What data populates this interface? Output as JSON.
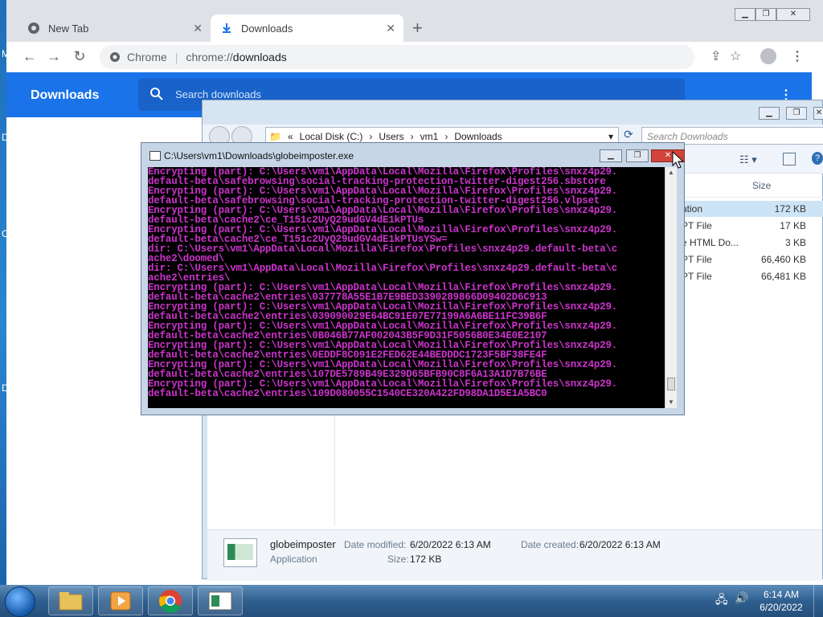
{
  "chrome": {
    "tabs": [
      {
        "label": "New Tab",
        "icon": "chrome-icon",
        "active": false
      },
      {
        "label": "Downloads",
        "icon": "download-icon",
        "active": true
      }
    ],
    "address": {
      "site_label": "Chrome",
      "url_prefix": "chrome://",
      "url_path": "downloads"
    },
    "downloads_page": {
      "title": "Downloads",
      "search_placeholder": "Search downloads"
    }
  },
  "explorer": {
    "breadcrumb": [
      "Local Disk (C:)",
      "Users",
      "vm1",
      "Downloads"
    ],
    "breadcrumb_prefix": "«",
    "search_placeholder": "Search Downloads",
    "column_header_size": "Size",
    "rows": [
      {
        "type": "ation",
        "size": "172 KB",
        "selected": true
      },
      {
        "type": "PT File",
        "size": "17 KB",
        "selected": false
      },
      {
        "type": "e HTML Do...",
        "size": "3 KB",
        "selected": false
      },
      {
        "type": "PT File",
        "size": "66,460 KB",
        "selected": false
      },
      {
        "type": "PT File",
        "size": "66,481 KB",
        "selected": false
      }
    ],
    "details": {
      "name": "globeimposter",
      "kind": "Application",
      "modified_label": "Date modified:",
      "modified_value": "6/20/2022 6:13 AM",
      "created_label": "Date created:",
      "created_value": "6/20/2022 6:13 AM",
      "size_label": "Size:",
      "size_value": "172 KB"
    }
  },
  "console": {
    "title": "C:\\Users\\vm1\\Downloads\\globeimposter.exe",
    "text_color": "#cc33cc",
    "lines": [
      "Encrypting (part): C:\\Users\\vm1\\AppData\\Local\\Mozilla\\Firefox\\Profiles\\snxz4p29.",
      "default-beta\\safebrowsing\\social-tracking-protection-twitter-digest256.sbstore",
      "Encrypting (part): C:\\Users\\vm1\\AppData\\Local\\Mozilla\\Firefox\\Profiles\\snxz4p29.",
      "default-beta\\safebrowsing\\social-tracking-protection-twitter-digest256.vlpset",
      "Encrypting (part): C:\\Users\\vm1\\AppData\\Local\\Mozilla\\Firefox\\Profiles\\snxz4p29.",
      "default-beta\\cache2\\ce_T151c2UyQ29udGV4dE1kPTUs",
      "Encrypting (part): C:\\Users\\vm1\\AppData\\Local\\Mozilla\\Firefox\\Profiles\\snxz4p29.",
      "default-beta\\cache2\\ce_T151c2UyQ29udGV4dE1kPTUsYSw=",
      "dir: C:\\Users\\vm1\\AppData\\Local\\Mozilla\\Firefox\\Profiles\\snxz4p29.default-beta\\c",
      "ache2\\doomed\\",
      "dir: C:\\Users\\vm1\\AppData\\Local\\Mozilla\\Firefox\\Profiles\\snxz4p29.default-beta\\c",
      "ache2\\entries\\",
      "Encrypting (part): C:\\Users\\vm1\\AppData\\Local\\Mozilla\\Firefox\\Profiles\\snxz4p29.",
      "default-beta\\cache2\\entries\\037778A55E1B7E9BED3390289866D09402D6C913",
      "Encrypting (part): C:\\Users\\vm1\\AppData\\Local\\Mozilla\\Firefox\\Profiles\\snxz4p29.",
      "default-beta\\cache2\\entries\\039090029E64BC91E07E77199A6A6BE11FC39B6F",
      "Encrypting (part): C:\\Users\\vm1\\AppData\\Local\\Mozilla\\Firefox\\Profiles\\snxz4p29.",
      "default-beta\\cache2\\entries\\0B046B77AF002043B5F9D31F5056B0E34E0E2107",
      "Encrypting (part): C:\\Users\\vm1\\AppData\\Local\\Mozilla\\Firefox\\Profiles\\snxz4p29.",
      "default-beta\\cache2\\entries\\0EDDF8C091E2FED62E44BEDDDC1723F5BF38FE4F",
      "Encrypting (part): C:\\Users\\vm1\\AppData\\Local\\Mozilla\\Firefox\\Profiles\\snxz4p29.",
      "default-beta\\cache2\\entries\\107DE5789B49E329D65BFB90C8F6A13A1D7B76BE",
      "Encrypting (part): C:\\Users\\vm1\\AppData\\Local\\Mozilla\\Firefox\\Profiles\\snxz4p29.",
      "default-beta\\cache2\\entries\\109D080055C1540CE320A422FD98DA1D5E1A5BC0"
    ]
  },
  "desktop": {
    "edge_letters": [
      "M",
      "D",
      "C",
      "D"
    ]
  },
  "taskbar": {
    "time": "6:14 AM",
    "date": "6/20/2022"
  }
}
